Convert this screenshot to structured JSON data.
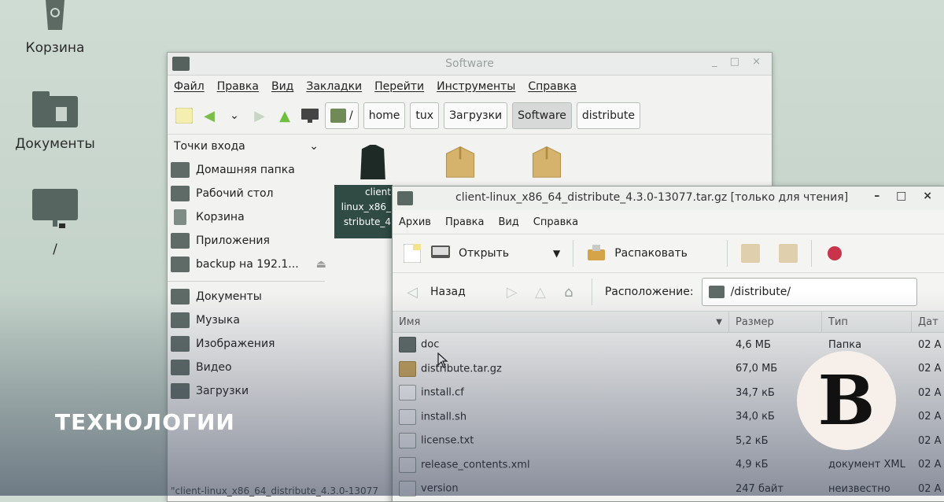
{
  "desktop": {
    "icons": [
      {
        "label": "Корзина",
        "icon": "trash-icon"
      },
      {
        "label": "Документы",
        "icon": "folder-documents-icon"
      },
      {
        "label": "/",
        "icon": "computer-icon"
      }
    ]
  },
  "file_manager": {
    "title": "Software",
    "menu": [
      "Файл",
      "Правка",
      "Вид",
      "Закладки",
      "Перейти",
      "Инструменты",
      "Справка"
    ],
    "path": [
      "/",
      "home",
      "tux",
      "Загрузки",
      "Software",
      "distribute"
    ],
    "active_path": "Software",
    "sidebar_header": "Точки входа",
    "sidebar_top": [
      {
        "label": "Домашняя папка",
        "icon": "home-folder-icon"
      },
      {
        "label": "Рабочий стол",
        "icon": "desktop-icon"
      },
      {
        "label": "Корзина",
        "icon": "trash-icon"
      },
      {
        "label": "Приложения",
        "icon": "applications-icon"
      },
      {
        "label": "backup на 192.1...",
        "icon": "network-drive-icon"
      }
    ],
    "sidebar_bookmarks": [
      {
        "label": "Документы",
        "icon": "folder-icon"
      },
      {
        "label": "Музыка",
        "icon": "folder-icon"
      },
      {
        "label": "Изображения",
        "icon": "folder-icon"
      },
      {
        "label": "Видео",
        "icon": "folder-icon"
      },
      {
        "label": "Загрузки",
        "icon": "folder-icon"
      }
    ],
    "selected_file_lines": [
      "client",
      "linux_x86_",
      "stribute_4"
    ],
    "status": "\"client-linux_x86_64_distribute_4.3.0-13077"
  },
  "archive": {
    "title": "client-linux_x86_64_distribute_4.3.0-13077.tar.gz [только для чтения]",
    "menu": [
      "Архив",
      "Правка",
      "Вид",
      "Справка"
    ],
    "open_label": "Открыть",
    "extract_label": "Распаковать",
    "back_label": "Назад",
    "location_label": "Расположение:",
    "location_value": "/distribute/",
    "columns": {
      "name": "Имя",
      "size": "Размер",
      "type": "Тип",
      "date": "Дат"
    },
    "rows": [
      {
        "name": "doc",
        "size": "4,6 МБ",
        "type": "Папка",
        "date": "02 А",
        "kind": "folder"
      },
      {
        "name": "distribute.tar.gz",
        "size": "67,0 МБ",
        "type": "",
        "date": "02 А",
        "kind": "pkg"
      },
      {
        "name": "install.cf",
        "size": "34,7 кБ",
        "type": "",
        "date": "02 А",
        "kind": "file"
      },
      {
        "name": "install.sh",
        "size": "34,0 кБ",
        "type": "",
        "date": "02 А",
        "kind": "file"
      },
      {
        "name": "license.txt",
        "size": "5,2 кБ",
        "type": "",
        "date": "02 А",
        "kind": "file"
      },
      {
        "name": "release_contents.xml",
        "size": "4,9 кБ",
        "type": "документ XML",
        "date": "02 А",
        "kind": "file"
      },
      {
        "name": "version",
        "size": "247 байт",
        "type": "неизвестно",
        "date": "02 А",
        "kind": "file"
      }
    ]
  },
  "overlay": {
    "section": "ТЕХНОЛОГИИ",
    "logo": "B"
  },
  "colors": {
    "desktop_bg": "#c4d3ca",
    "selection": "#2f4b43",
    "logo_bg": "#f7f0ea"
  }
}
